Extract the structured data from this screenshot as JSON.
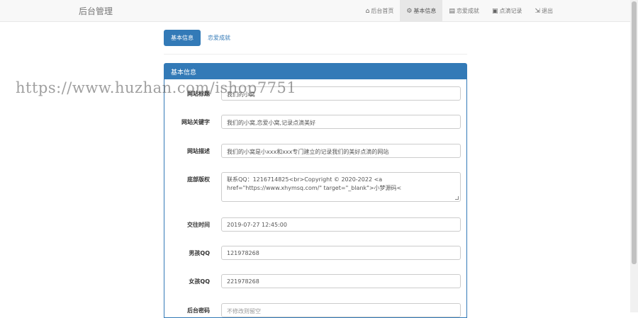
{
  "navbar": {
    "brand": "后台管理",
    "items": [
      {
        "icon": "home-icon",
        "glyph": "⌂",
        "label": "后台首页"
      },
      {
        "icon": "gear-icon",
        "glyph": "⚙",
        "label": "基本信息"
      },
      {
        "icon": "list-icon",
        "glyph": "▤",
        "label": "恋爱成就"
      },
      {
        "icon": "picture-icon",
        "glyph": "▣",
        "label": "点滴记录"
      },
      {
        "icon": "logout-icon",
        "glyph": "⇲",
        "label": "退出"
      }
    ]
  },
  "tabs": [
    {
      "label": "基本信息"
    },
    {
      "label": "恋爱成就"
    }
  ],
  "panel": {
    "title": "基本信息",
    "fields": [
      {
        "label": "网站标题",
        "value": "我们的小窝"
      },
      {
        "label": "网站关键字",
        "value": "我们的小窝,恋爱小窝,记录点滴美好"
      },
      {
        "label": "网站描述",
        "value": "我们的小窝是小xxx和xxx专门建立的记录我们的美好点滴的网站"
      },
      {
        "label": "底部版权",
        "value": "联系QQ：1216714825<br>Copyright © 2020-2022 <a href=\"https://www.xhymsq.com/\" target=\"_blank\">小梦源码<"
      },
      {
        "label": "交往时间",
        "value": "2019-07-27 12:45:00"
      },
      {
        "label": "男孩QQ",
        "value": "121978268"
      },
      {
        "label": "女孩QQ",
        "value": "221978268"
      },
      {
        "label": "后台密码",
        "placeholder": "不修改则留空"
      }
    ]
  },
  "watermark": "https://www.huzhan.com/ishop7751",
  "colors": {
    "primary": "#337ab7",
    "navbar_bg": "#f8f8f8",
    "active_nav": "#e7e7e7"
  }
}
